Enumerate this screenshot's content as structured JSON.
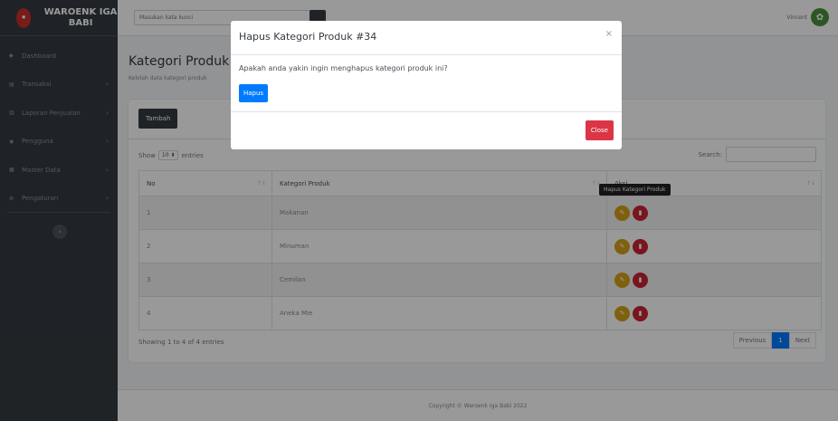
{
  "brand": {
    "title": "WAROENK IGA BABI",
    "logo_icon": "logo-icon"
  },
  "sidebar": {
    "items": [
      {
        "label": "Dashboard",
        "icon": "dashboard-icon",
        "has_chevron": false
      },
      {
        "label": "Transaksi",
        "icon": "cart-icon",
        "has_chevron": true
      },
      {
        "label": "Laporan Penjualan",
        "icon": "report-icon",
        "has_chevron": true
      },
      {
        "label": "Pengguna",
        "icon": "users-icon",
        "has_chevron": true
      },
      {
        "label": "Master Data",
        "icon": "database-icon",
        "has_chevron": true
      },
      {
        "label": "Pengaturan",
        "icon": "gear-icon",
        "has_chevron": true
      }
    ],
    "collapse_glyph": "‹"
  },
  "topbar": {
    "search_placeholder": "Masukan kata kunci",
    "user_name": "Vincent"
  },
  "page": {
    "title": "Kategori Produk",
    "subtitle": "Kelolah data kategori produk"
  },
  "card": {
    "add_label": "Tambah",
    "show_label": "Show",
    "show_value": "10",
    "entries_label": "entries",
    "search_label": "Search:",
    "columns": [
      "No",
      "Kategori Produk",
      "Aksi"
    ],
    "rows": [
      {
        "no": "1",
        "kategori": "Makanan"
      },
      {
        "no": "2",
        "kategori": "Minuman"
      },
      {
        "no": "3",
        "kategori": "Cemilan"
      },
      {
        "no": "4",
        "kategori": "Aneka Mie"
      }
    ],
    "tooltip": "Hapus Kategori Produk",
    "showing_text": "Showing 1 to 4 of 4 entries",
    "pager": {
      "prev": "Previous",
      "current": "1",
      "next": "Next"
    }
  },
  "footer": {
    "text": "Copyright © Waroenk Iga Babi 2022"
  },
  "modal": {
    "title": "Hapus Kategori Produk #34",
    "close_glyph": "×",
    "message": "Apakah anda yakin ingin menghapus kategori produk ini?",
    "confirm_label": "Hapus",
    "close_label": "Close"
  },
  "colors": {
    "sidebar_bg": "#343a40",
    "primary": "#007bff",
    "danger": "#dc3545",
    "warning": "#d4a017"
  }
}
